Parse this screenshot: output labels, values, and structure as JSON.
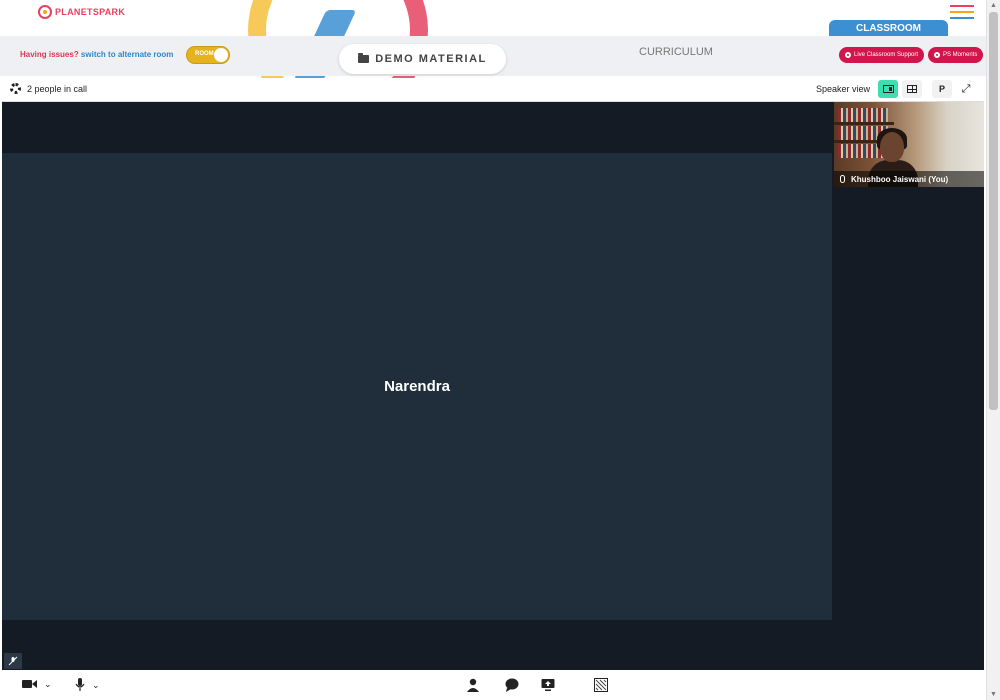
{
  "brand": {
    "logo_part1": "PLANET",
    "logo_part2": "SPARK"
  },
  "header": {
    "classroom_tab": "CLASSROOM",
    "menu_icon": "hamburger-icon",
    "menu_colors": [
      "#e8405e",
      "#f3a51e",
      "#3c8fd1"
    ]
  },
  "subbar": {
    "issues_text": "Having issues?",
    "switch_text": "switch to alternate room",
    "toggle_label": "ROOM",
    "demo_material": "DEMO MATERIAL",
    "curriculum": "CURRICULUM",
    "live_support": "Live Classroom Support",
    "ps_moments": "PS Moments"
  },
  "call": {
    "people_count": "2 people in call",
    "view_label": "Speaker view",
    "p_button": "P"
  },
  "video": {
    "main_participant": "Narendra",
    "self_participant": "Khushboo Jaiswani (You)"
  },
  "colors": {
    "accent_red": "#d0164b",
    "accent_blue": "#3c8fd1",
    "active_view": "#3ddfb0",
    "video_bg": "#141b24",
    "tile_bg": "#202d3b"
  }
}
